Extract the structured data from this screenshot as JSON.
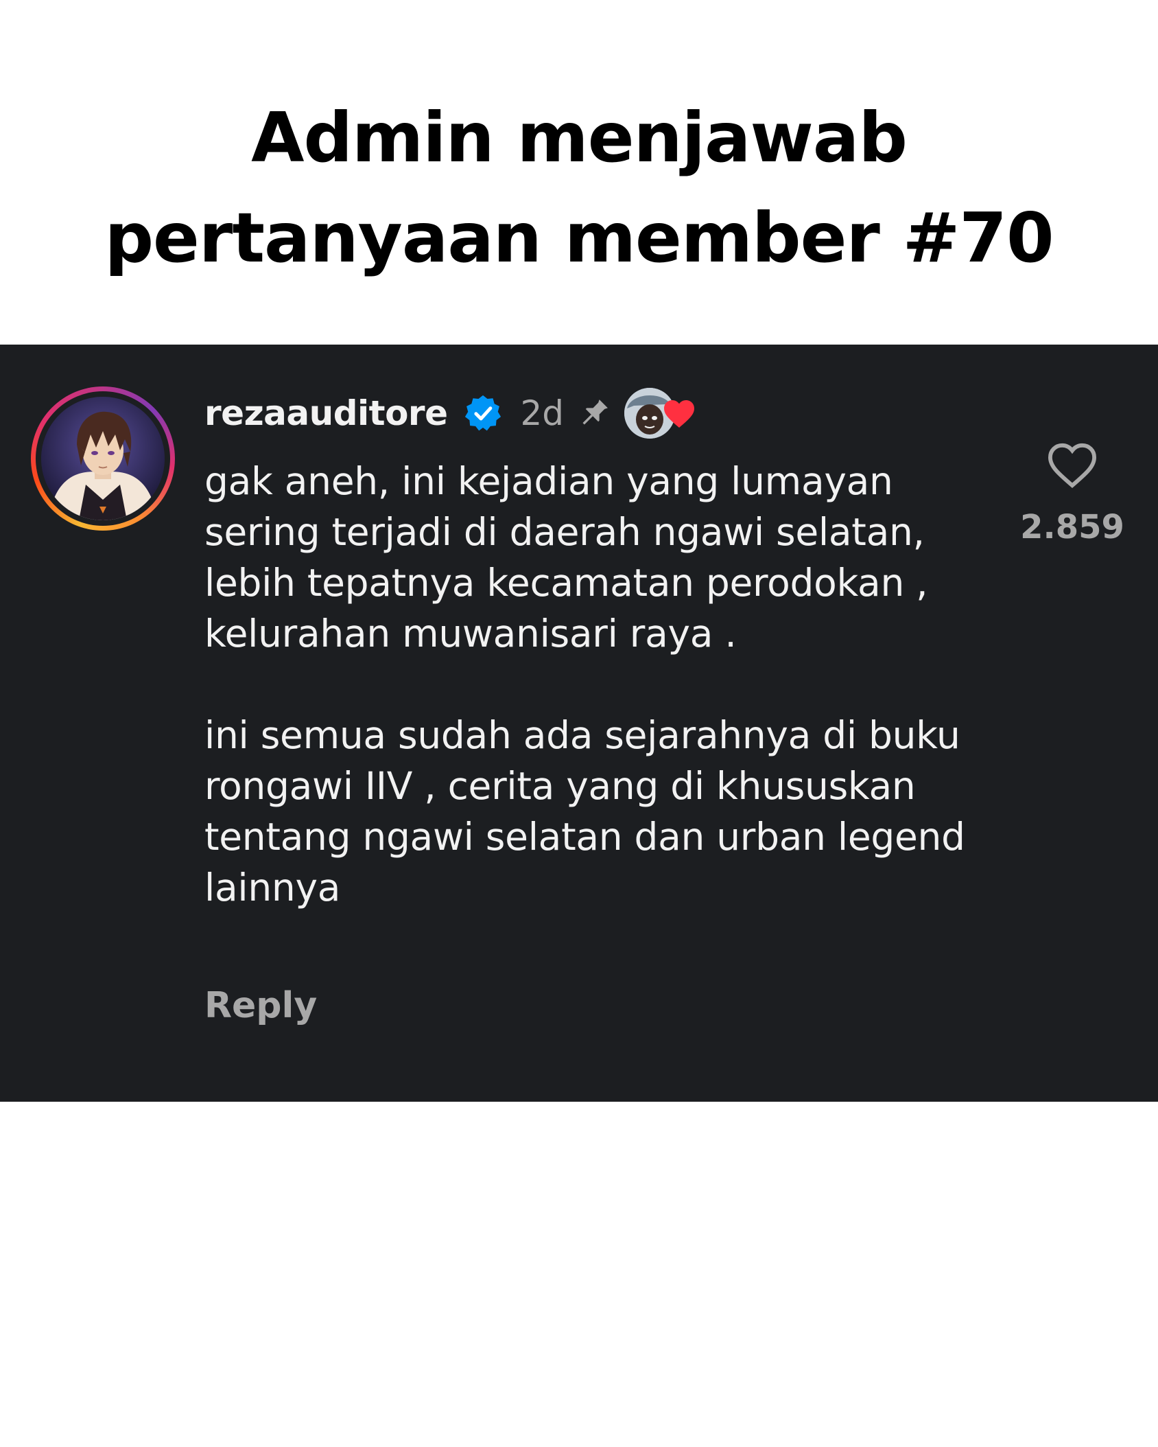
{
  "headline": {
    "line1": "Admin menjawab",
    "line2": "pertanyaan member #70"
  },
  "comment": {
    "username": "rezaauditore",
    "verified": true,
    "time": "2d",
    "pinned": true,
    "liked_by_creator": true,
    "body_paragraph_1": "gak aneh, ini kejadian yang lumayan sering terjadi di daerah ngawi selatan, lebih tepatnya kecamatan perodokan , kelurahan muwanisari raya .",
    "body_paragraph_2": "ini semua sudah ada sejarahnya di buku rongawi IIV , cerita yang di khususkan tentang ngawi selatan dan urban legend lainnya",
    "reply_label": "Reply",
    "like_count": "2.859"
  },
  "icons": {
    "verified": "verified-badge-icon",
    "pin": "pin-icon",
    "creator_heart": "heart-filled-icon",
    "like": "heart-outline-icon"
  },
  "colors": {
    "card_background": "#1c1e21",
    "verified_blue": "#0095f6",
    "heart_red": "#ff3040",
    "muted_text": "#a8a8a8"
  }
}
